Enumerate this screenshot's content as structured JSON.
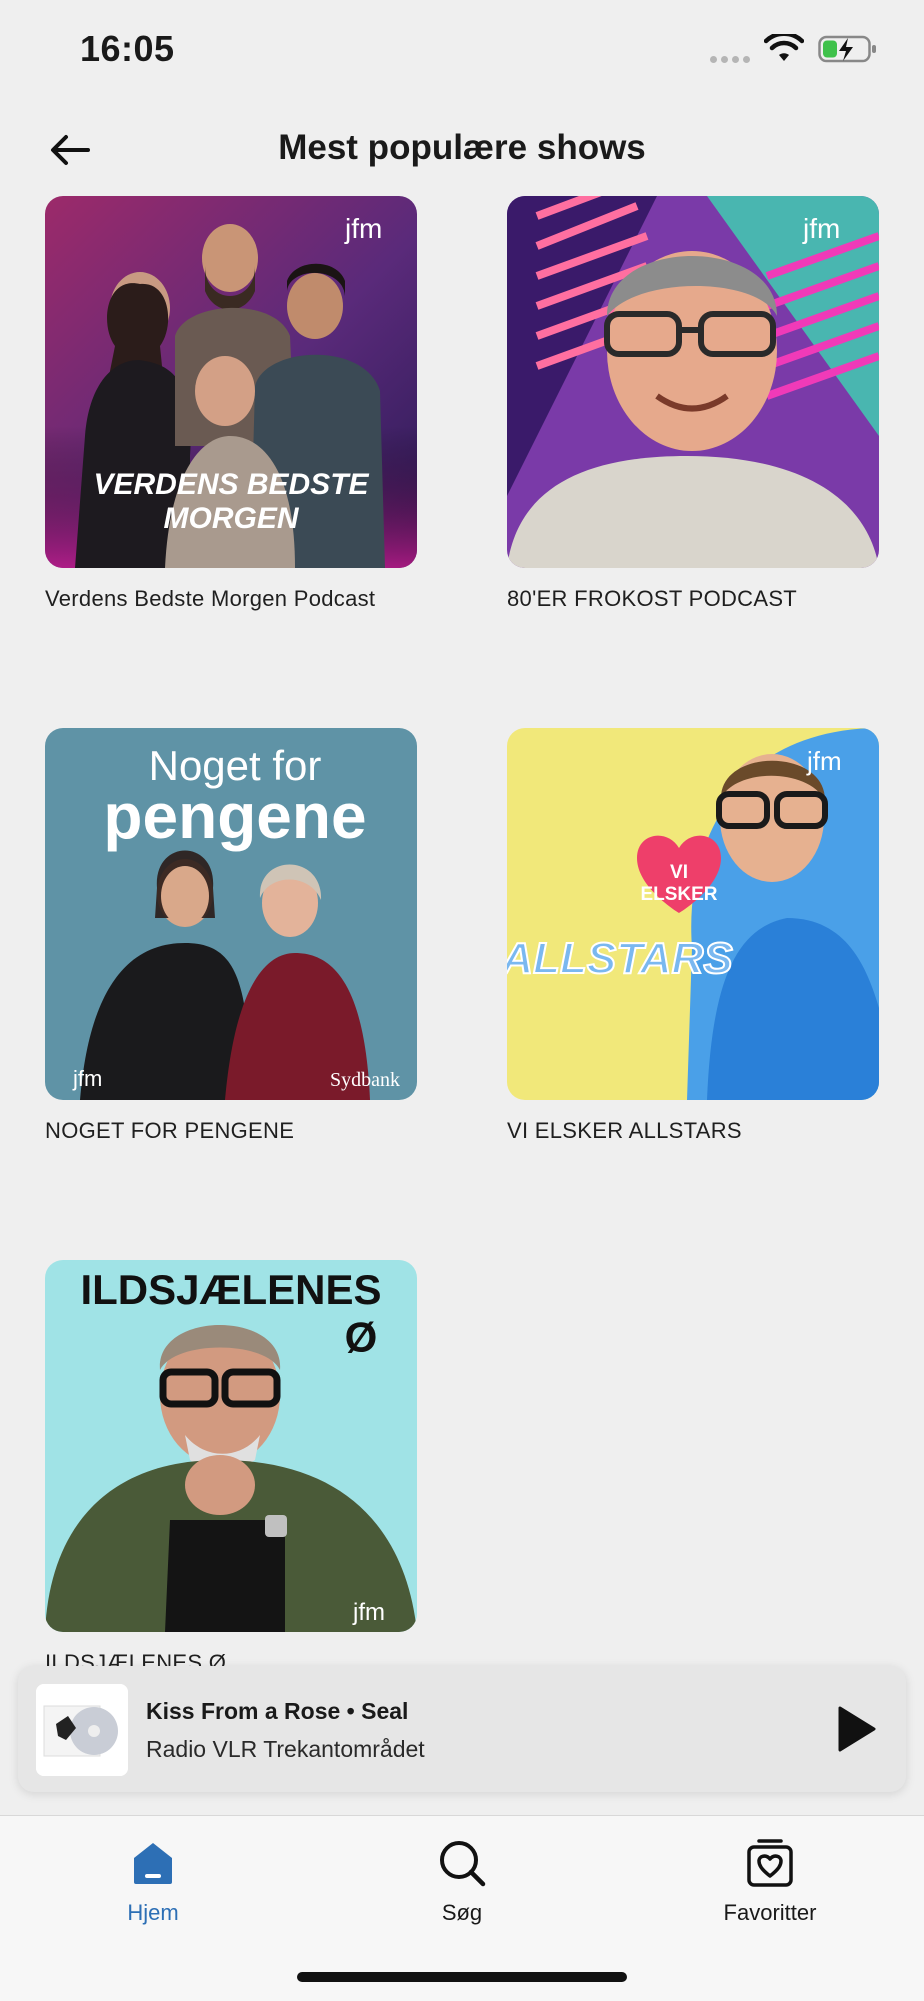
{
  "status_bar": {
    "time": "16:05"
  },
  "header": {
    "title": "Mest populære shows"
  },
  "shows": [
    {
      "title": "Verdens Bedste Morgen Podcast",
      "cover_text": "VERDENS BEDSTE MORGEN",
      "brand": "jfm"
    },
    {
      "title": "80'ER FROKOST PODCAST",
      "brand": "jfm"
    },
    {
      "title": "NOGET FOR PENGENE",
      "cover_text_top": "Noget for",
      "cover_text_main": "pengene",
      "brand": "jfm",
      "sponsor": "Sydbank"
    },
    {
      "title": "VI ELSKER ALLSTARS",
      "cover_text_heart": "VI ELSKER",
      "cover_text_main": "ALLSTARS",
      "brand": "jfm"
    },
    {
      "title": "ILDSJÆLENES Ø",
      "cover_text_main": "ILDSJÆLENES",
      "cover_text_sub": "Ø",
      "brand": "jfm"
    }
  ],
  "player": {
    "track": "Kiss From a Rose • Seal",
    "station": "Radio VLR Trekantområdet"
  },
  "tabs": [
    {
      "label": "Hjem",
      "icon": "home-icon",
      "active": true
    },
    {
      "label": "Søg",
      "icon": "search-icon",
      "active": false
    },
    {
      "label": "Favoritter",
      "icon": "favorites-icon",
      "active": false
    }
  ],
  "colors": {
    "accent": "#2d6fb5",
    "background": "#efefef"
  }
}
